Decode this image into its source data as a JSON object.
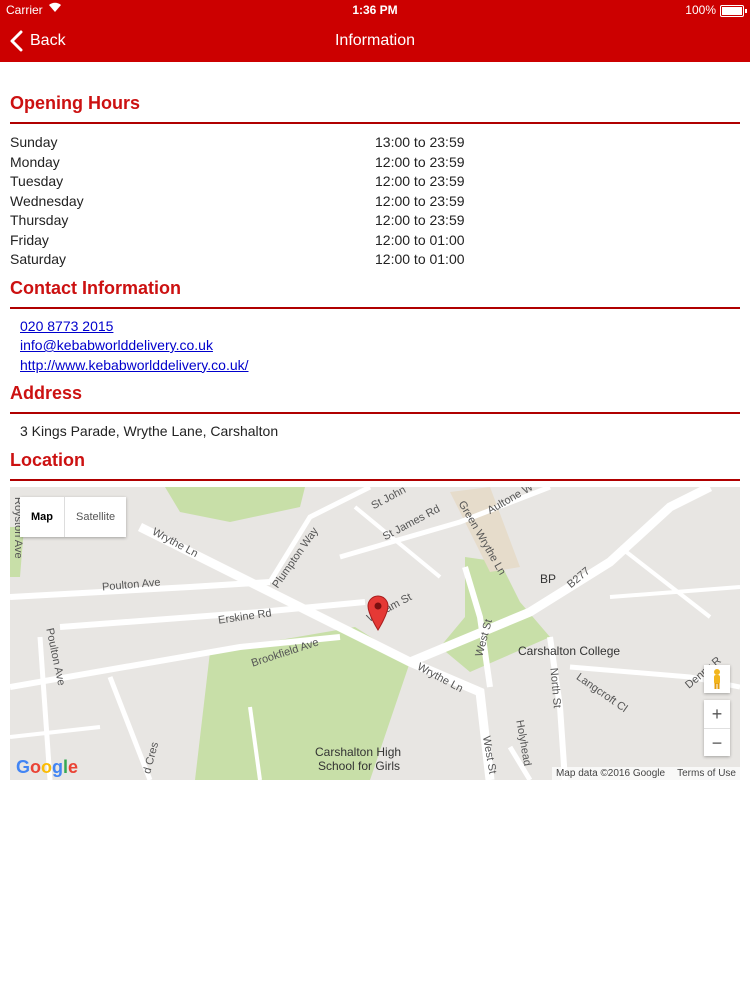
{
  "status_bar": {
    "carrier": "Carrier",
    "time": "1:36 PM",
    "battery": "100%"
  },
  "nav": {
    "back_label": "Back",
    "title": "Information"
  },
  "opening_hours": {
    "heading": "Opening Hours",
    "rows": [
      {
        "day": "Sunday",
        "time": "13:00 to 23:59"
      },
      {
        "day": "Monday",
        "time": "12:00 to 23:59"
      },
      {
        "day": "Tuesday",
        "time": "12:00 to 23:59"
      },
      {
        "day": "Wednesday",
        "time": "12:00 to 23:59"
      },
      {
        "day": "Thursday",
        "time": "12:00 to 23:59"
      },
      {
        "day": "Friday",
        "time": "12:00 to 01:00"
      },
      {
        "day": "Saturday",
        "time": "12:00 to 01:00"
      }
    ]
  },
  "contact": {
    "heading": "Contact Information",
    "phone": "020 8773 2015",
    "email": "info@kebabworlddelivery.co.uk",
    "website": "http://www.kebabworlddelivery.co.uk/"
  },
  "address": {
    "heading": "Address",
    "text": "3 Kings Parade, Wrythe Lane, Carshalton"
  },
  "location": {
    "heading": "Location",
    "map_type_map": "Map",
    "map_type_satellite": "Satellite",
    "zoom_in": "+",
    "zoom_out": "−",
    "attribution": "Map data ©2016 Google",
    "terms": "Terms of Use",
    "labels": {
      "wrythe_ln_1": "Wrythe Ln",
      "wrythe_ln_2": "Wrythe Ln",
      "poulton_ave_1": "Poulton Ave",
      "poulton_ave_2": "Poulton Ave",
      "royston_ave": "Royston Ave",
      "plumpton_way": "Plumpton Way",
      "st_james_rd": "St James Rd",
      "st_john": "St John",
      "green_wrythe_ln": "Green Wrythe Ln",
      "aultone": "Aultone W",
      "bp": "BP",
      "b277": "B277",
      "erskine_rd": "Erskine Rd",
      "william_st": "William St",
      "brookfield_ave": "Brookfield Ave",
      "west_st_1": "West St",
      "west_st_2": "West St",
      "carshalton_college": "Carshalton College",
      "north_st": "North St",
      "langcroft_cl": "Langcroft Cl",
      "denny": "Denny R",
      "holyhead": "Holyhead",
      "cres": "d Cres",
      "school_line1": "Carshalton High",
      "school_line2": "School for Girls"
    },
    "colors": {
      "land": "#e8e6e3",
      "park": "#c8dfa8",
      "road": "#ffffff",
      "pin": "#e53935"
    }
  },
  "colors": {
    "brand": "#cc0000",
    "heading": "#cc1111",
    "link": "#0000cc"
  }
}
